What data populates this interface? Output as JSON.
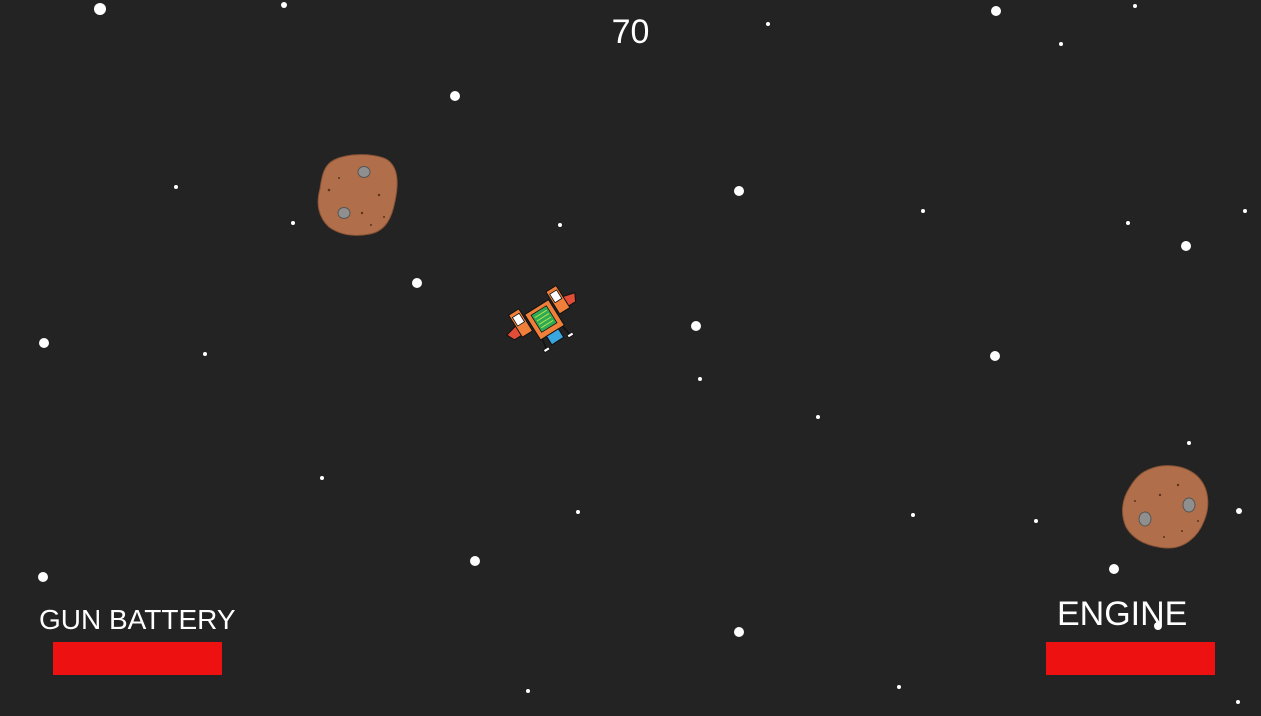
{
  "hud": {
    "score": "70",
    "gun_battery": {
      "label": "GUN BATTERY",
      "level": 1.0,
      "color": "#ee1111"
    },
    "engine": {
      "label": "ENGINE",
      "level": 1.0,
      "color": "#ee1111"
    }
  },
  "entities": {
    "player": {
      "icon": "spaceship-icon",
      "colors": {
        "hull": "#f07f3a",
        "core": "#2eaa55",
        "cockpit": "#3aa6e0",
        "wings": "#e24d38"
      }
    },
    "asteroids": [
      {
        "icon": "asteroid-icon",
        "color": "#b06f4a"
      },
      {
        "icon": "asteroid-icon",
        "color": "#b06f4a"
      }
    ]
  },
  "background": {
    "color": "#232323",
    "star_color": "#ffffff"
  }
}
